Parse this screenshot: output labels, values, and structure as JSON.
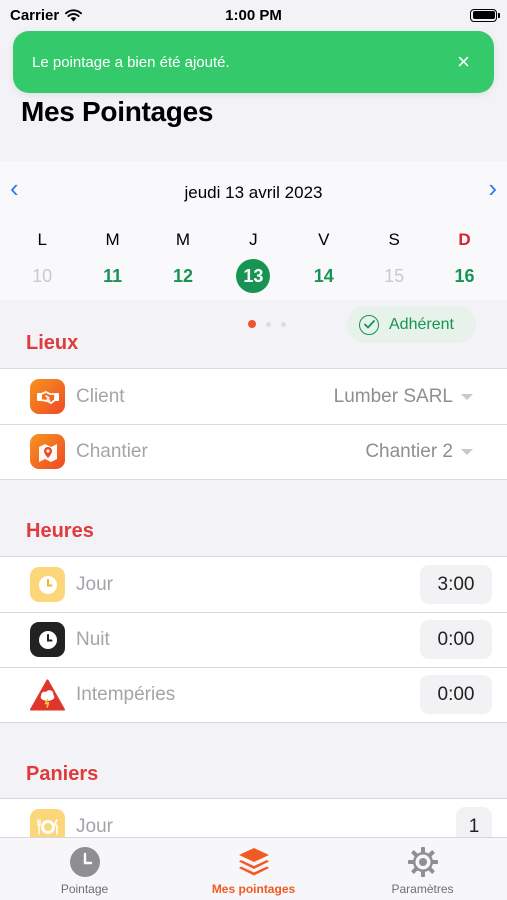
{
  "status_bar": {
    "carrier": "Carrier",
    "time": "1:00 PM"
  },
  "toast": {
    "message": "Le pointage a bien été ajouté.",
    "close_icon": "×"
  },
  "page": {
    "title": "Mes Pointages"
  },
  "calendar": {
    "date_label": "jeudi 13 avril 2023",
    "prev_icon": "‹",
    "next_icon": "›",
    "days": [
      {
        "letter": "L",
        "number": "10",
        "state": "muted"
      },
      {
        "letter": "M",
        "number": "11",
        "state": "normal"
      },
      {
        "letter": "M",
        "number": "12",
        "state": "normal"
      },
      {
        "letter": "J",
        "number": "13",
        "state": "selected"
      },
      {
        "letter": "V",
        "number": "14",
        "state": "normal"
      },
      {
        "letter": "S",
        "number": "15",
        "state": "muted"
      },
      {
        "letter": "D",
        "number": "16",
        "state": "sunday"
      }
    ]
  },
  "badge": {
    "label": "Adhérent",
    "icon": "checkmark-circle-icon"
  },
  "sections": {
    "lieux": {
      "title": "Lieux",
      "rows": [
        {
          "label": "Client",
          "value": "Lumber SARL",
          "icon": "handshake-icon"
        },
        {
          "label": "Chantier",
          "value": "Chantier 2",
          "icon": "map-pin-icon"
        }
      ]
    },
    "heures": {
      "title": "Heures",
      "rows": [
        {
          "label": "Jour",
          "value": "3:00",
          "icon": "clock-icon"
        },
        {
          "label": "Nuit",
          "value": "0:00",
          "icon": "clock-icon"
        },
        {
          "label": "Intempéries",
          "value": "0:00",
          "icon": "storm-warning-icon"
        }
      ]
    },
    "paniers": {
      "title": "Paniers",
      "rows": [
        {
          "label": "Jour",
          "value": "1",
          "icon": "meal-icon"
        }
      ]
    }
  },
  "tabbar": {
    "tabs": [
      {
        "label": "Pointage",
        "icon": "clock-icon"
      },
      {
        "label": "Mes pointages",
        "icon": "layers-icon",
        "active": true
      },
      {
        "label": "Paramètres",
        "icon": "gear-icon"
      }
    ]
  },
  "colors": {
    "toast": "#34c96a",
    "accent_green": "#179454",
    "section_red": "#e03a3a",
    "active_tab": "#f15a24",
    "nav_blue": "#2f7cf6"
  }
}
